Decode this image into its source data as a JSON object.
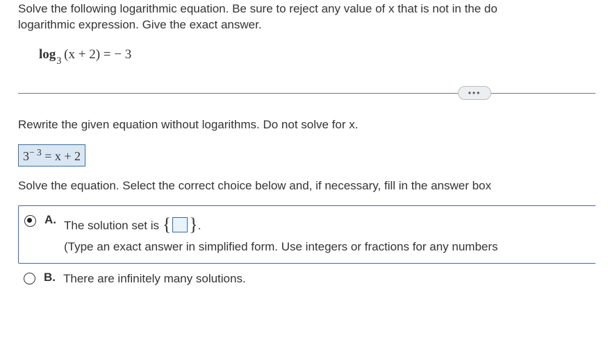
{
  "question": {
    "line1": "Solve the following logarithmic equation. Be sure to reject any value of x that is not in the do",
    "line2": "logarithmic expression. Give the exact answer."
  },
  "equation": {
    "log_word": "log",
    "base": "3",
    "argument": "(x + 2)",
    "equals": " = ",
    "rhs": "− 3"
  },
  "ellipsis": "•••",
  "step1_text": "Rewrite the given equation without logarithms. Do not solve for x.",
  "rewritten": {
    "base": "3",
    "exponent": "− 3",
    "equals": " = ",
    "rhs": "x + 2"
  },
  "step2_text": "Solve the equation. Select the correct choice below and, if necessary, fill in the answer box",
  "choices": {
    "a": {
      "letter": "A.",
      "text_before": "The solution set is ",
      "text_after": ".",
      "hint": "(Type an exact answer in simplified form. Use integers or fractions for any numbers"
    },
    "b": {
      "letter": "B.",
      "text": "There are infinitely many solutions."
    }
  }
}
